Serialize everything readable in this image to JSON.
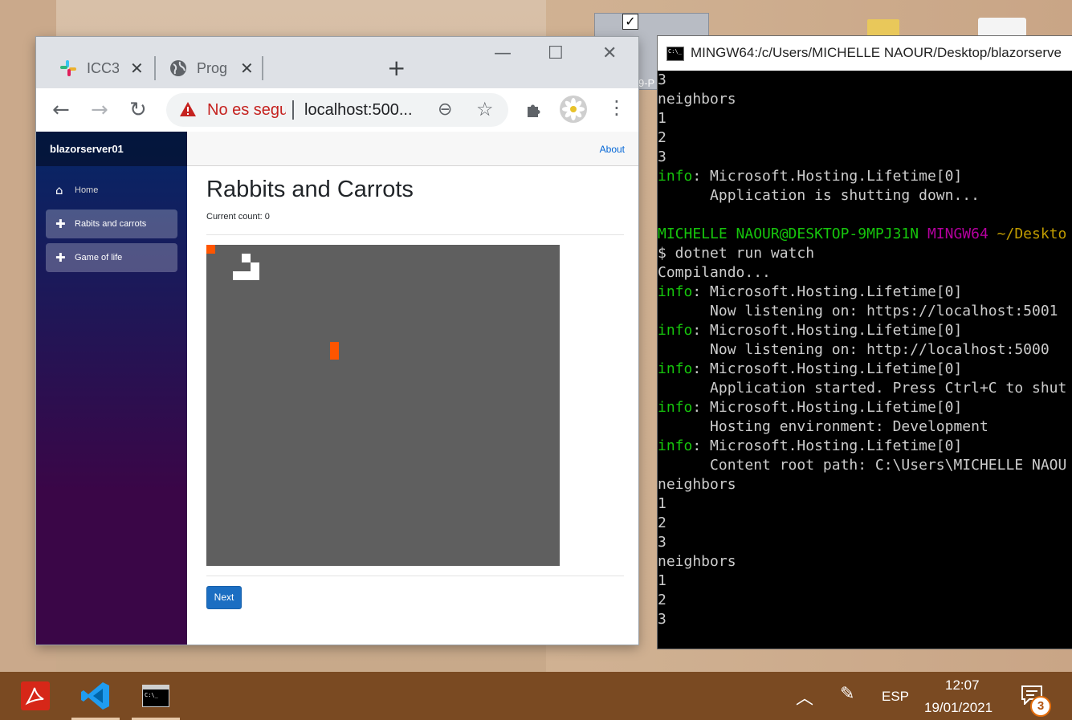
{
  "browser": {
    "tabs": [
      {
        "title": "ICC3",
        "favicon": "slack-icon"
      },
      {
        "title": "Prog",
        "favicon": "globe-icon"
      }
    ],
    "new_tab": "+",
    "address": {
      "security_label": "No es segu",
      "url": "localhost:500..."
    }
  },
  "app": {
    "brand": "blazorserver01",
    "nav": [
      {
        "label": "Home",
        "icon": "home-icon",
        "active": false
      },
      {
        "label": "Rabits and carrots",
        "icon": "plus-icon",
        "active": true
      },
      {
        "label": "Game of life",
        "icon": "plus-icon",
        "active": false
      }
    ],
    "top_link": "About",
    "page_title": "Rabbits and Carrots",
    "count_text": "Current count: 0",
    "next_button": "Next",
    "board": {
      "background": "#5f5f5f",
      "cells": [
        {
          "color": "#ff5500",
          "col": 0,
          "row": 0
        },
        {
          "color": "#ffffff",
          "col": 4,
          "row": 1
        },
        {
          "color": "#ffffff",
          "col": 5,
          "row": 2
        },
        {
          "color": "#ffffff",
          "col": 3,
          "row": 3
        },
        {
          "color": "#ffffff",
          "col": 4,
          "row": 3
        },
        {
          "color": "#ffffff",
          "col": 5,
          "row": 3
        },
        {
          "color": "#ff5500",
          "col": 14,
          "row": 11
        },
        {
          "color": "#ff5500",
          "col": 14,
          "row": 12
        }
      ]
    }
  },
  "terminal": {
    "title": "MINGW64:/c/Users/MICHELLE NAOUR/Desktop/blazorserve",
    "lines": [
      [
        {
          "t": "3"
        }
      ],
      [
        {
          "t": "neighbors"
        }
      ],
      [
        {
          "t": "1"
        }
      ],
      [
        {
          "t": "2"
        }
      ],
      [
        {
          "t": "3"
        }
      ],
      [
        {
          "t": "info",
          "c": "c-green"
        },
        {
          "t": ": Microsoft.Hosting.Lifetime[0]"
        }
      ],
      [
        {
          "t": "      Application is shutting down..."
        }
      ],
      [
        {
          "t": ""
        }
      ],
      [
        {
          "t": "MICHELLE NAOUR@DESKTOP-9MPJ31N ",
          "c": "c-green"
        },
        {
          "t": "MINGW64 ",
          "c": "c-magenta"
        },
        {
          "t": "~/Deskto",
          "c": "c-yellow"
        }
      ],
      [
        {
          "t": "$ dotnet run watch"
        }
      ],
      [
        {
          "t": "Compilando..."
        }
      ],
      [
        {
          "t": "info",
          "c": "c-green"
        },
        {
          "t": ": Microsoft.Hosting.Lifetime[0]"
        }
      ],
      [
        {
          "t": "      Now listening on: https://localhost:5001"
        }
      ],
      [
        {
          "t": "info",
          "c": "c-green"
        },
        {
          "t": ": Microsoft.Hosting.Lifetime[0]"
        }
      ],
      [
        {
          "t": "      Now listening on: http://localhost:5000"
        }
      ],
      [
        {
          "t": "info",
          "c": "c-green"
        },
        {
          "t": ": Microsoft.Hosting.Lifetime[0]"
        }
      ],
      [
        {
          "t": "      Application started. Press Ctrl+C to shut"
        }
      ],
      [
        {
          "t": "info",
          "c": "c-green"
        },
        {
          "t": ": Microsoft.Hosting.Lifetime[0]"
        }
      ],
      [
        {
          "t": "      Hosting environment: Development"
        }
      ],
      [
        {
          "t": "info",
          "c": "c-green"
        },
        {
          "t": ": Microsoft.Hosting.Lifetime[0]"
        }
      ],
      [
        {
          "t": "      Content root path: C:\\Users\\MICHELLE NAOU"
        }
      ],
      [
        {
          "t": "neighbors"
        }
      ],
      [
        {
          "t": "1"
        }
      ],
      [
        {
          "t": "2"
        }
      ],
      [
        {
          "t": "3"
        }
      ],
      [
        {
          "t": "neighbors"
        }
      ],
      [
        {
          "t": "1"
        }
      ],
      [
        {
          "t": "2"
        }
      ],
      [
        {
          "t": "3"
        }
      ]
    ]
  },
  "desktop": {
    "label_fragment": "9-P"
  },
  "taskbar": {
    "apps": [
      {
        "name": "acrobat-icon",
        "running": false
      },
      {
        "name": "vscode-icon",
        "running": true
      },
      {
        "name": "terminal-icon",
        "running": true
      }
    ],
    "language": "ESP",
    "time": "12:07",
    "date": "19/01/2021",
    "notifications": "3"
  }
}
